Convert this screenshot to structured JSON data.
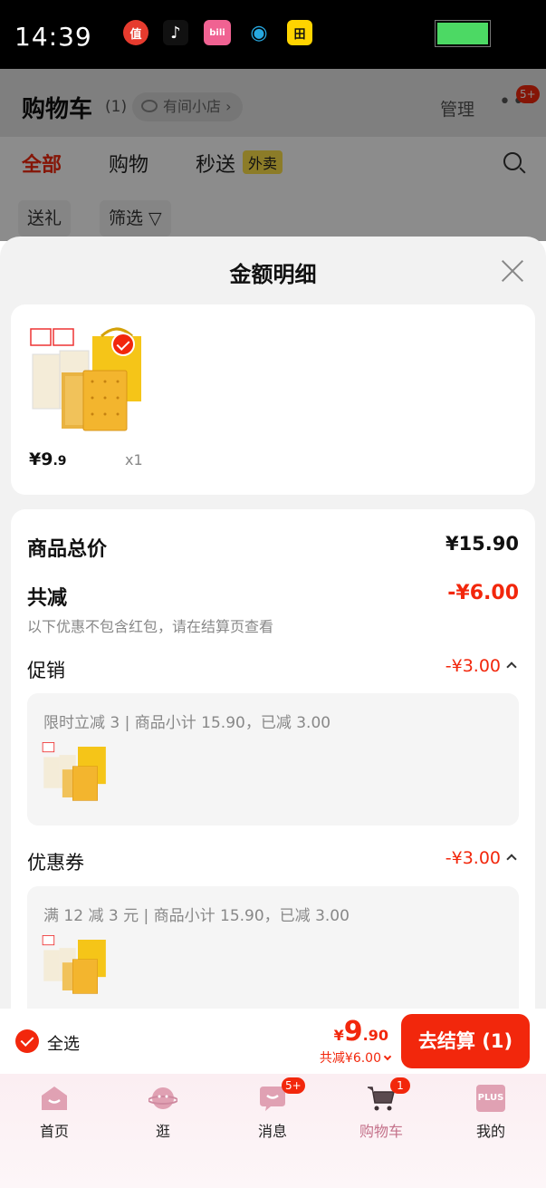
{
  "status_bar": {
    "time": "14:39",
    "apps": [
      {
        "name": "zhi-app-icon",
        "glyph": "值",
        "color": "#e63b2e"
      },
      {
        "name": "tiktok-icon",
        "glyph": "♪",
        "color": "#111111"
      },
      {
        "name": "bilibili-icon",
        "glyph": "bili",
        "color": "#f06292"
      },
      {
        "name": "qq-icon",
        "glyph": "◉",
        "color": "#27a8e0"
      },
      {
        "name": "tianchao-icon",
        "glyph": "田",
        "color": "#ffd400"
      }
    ]
  },
  "background_page": {
    "title": "购物车",
    "count": "(1)",
    "shop_label": "有间小店 ›",
    "manage": "管理",
    "more": "•••",
    "more_badge": "5+",
    "tabs": [
      "全部",
      "购物",
      "秒送"
    ],
    "waimai": "外卖",
    "sub_tabs": [
      "送礼",
      "筛选 ▽"
    ]
  },
  "sheet": {
    "title": "金额明细",
    "product": {
      "price_main": "¥9",
      "price_decimal": ".9",
      "quantity": "x1"
    },
    "summary": {
      "total_label": "商品总价",
      "total_value": "¥15.90",
      "discount_label": "共减",
      "discount_value": "-¥6.00",
      "discount_note": "以下优惠不包含红包，请在结算页查看"
    },
    "promotion": {
      "label": "促销",
      "value": "-¥3.00",
      "detail": "限时立减 3 | 商品小计 15.90，已减 3.00"
    },
    "coupon": {
      "label": "优惠券",
      "value": "-¥3.00",
      "detail": "满 12 减 3 元 | 商品小计 15.90，已减 3.00"
    }
  },
  "checkout": {
    "select_all": "全选",
    "yen": "¥",
    "total_int": "9",
    "total_dec": ".90",
    "saved": "共减¥6.00",
    "button": "去结算 (1)"
  },
  "tabbar": {
    "items": [
      {
        "label": "首页",
        "badge": ""
      },
      {
        "label": "逛",
        "badge": ""
      },
      {
        "label": "消息",
        "badge": "5+"
      },
      {
        "label": "购物车",
        "badge": "1"
      },
      {
        "label": "我的",
        "badge": ""
      }
    ],
    "plus_text": "PLUS",
    "active_index": 3
  },
  "colors": {
    "accent": "#f2270c",
    "active_tab": "#c4718a"
  }
}
